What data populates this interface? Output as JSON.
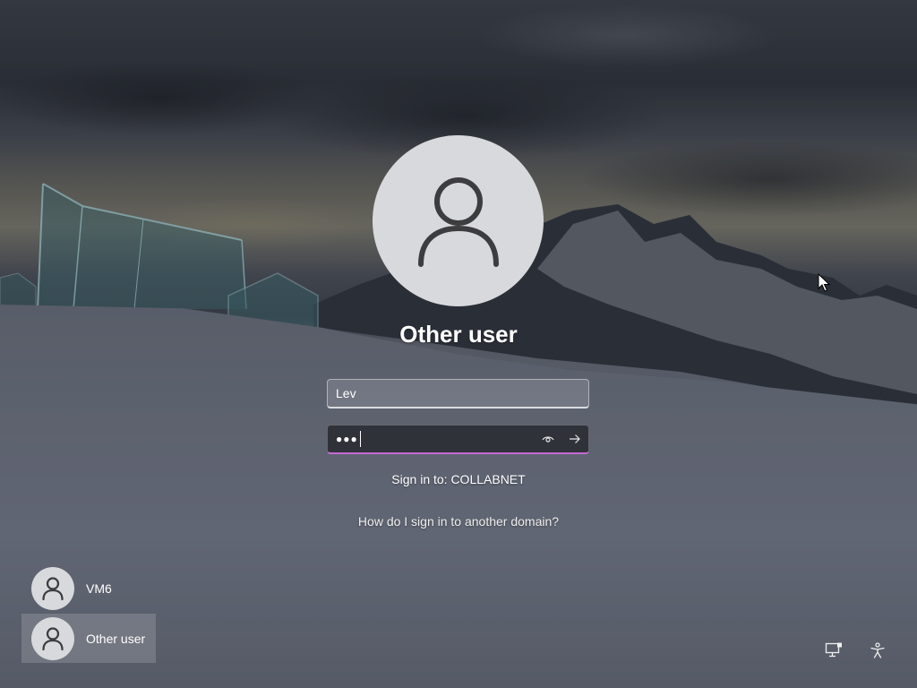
{
  "selected_user": {
    "name": "Other user",
    "icon": "person-icon"
  },
  "login_form": {
    "username_value": "Lev",
    "password_mask": "●●●",
    "reveal_icon": "eye-icon",
    "submit_icon": "arrow-right-icon",
    "sign_in_to": "Sign in to: COLLABNET",
    "domain_help_link": "How do I sign in to another domain?",
    "focus_accent_color": "#c46ad6"
  },
  "user_list": [
    {
      "name": "VM6",
      "icon": "person-icon",
      "selected": false
    },
    {
      "name": "Other user",
      "icon": "person-icon",
      "selected": true
    }
  ],
  "system_tray": {
    "network_icon": "network-icon",
    "accessibility_icon": "accessibility-icon"
  }
}
